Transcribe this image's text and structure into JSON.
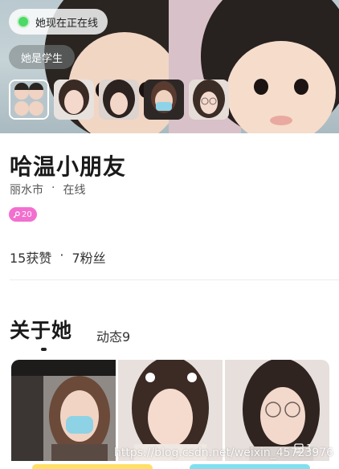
{
  "cover": {
    "online_status": "她现在正在线",
    "tag": "她是学生",
    "status_color": "#4cd964",
    "thumbnails": [
      "photo-1",
      "photo-2",
      "photo-3",
      "photo-4",
      "photo-5"
    ]
  },
  "profile": {
    "name": "哈温小朋友",
    "city": "丽水市",
    "separator": "·",
    "presence": "在线",
    "level_icon": "key-icon",
    "level": "20",
    "level_color": "#f26fcf",
    "likes": "15获赞",
    "followers": "7粉丝"
  },
  "tabs": {
    "about": "关于她",
    "moments": "动态9"
  },
  "gallery": {
    "photos": [
      "gallery-photo-1",
      "gallery-photo-2",
      "gallery-photo-3"
    ],
    "count": "1",
    "watermark": "https://blog.csdn.net/weixin_45723976"
  }
}
